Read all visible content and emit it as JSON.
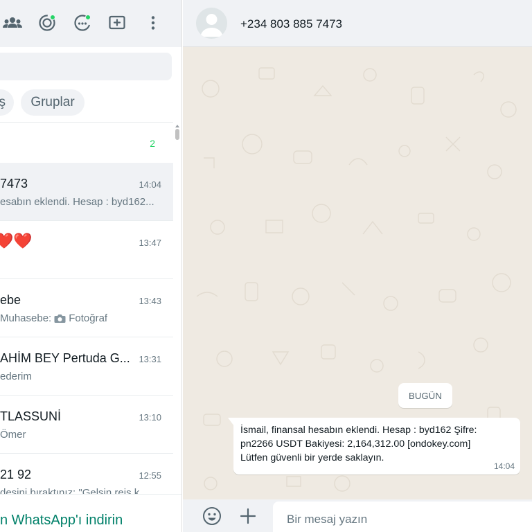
{
  "left_header": {
    "icons": [
      "communities-icon",
      "status-icon",
      "channels-icon",
      "new-chat-icon",
      "menu-icon"
    ]
  },
  "search": {
    "placeholder": ""
  },
  "filters": [
    {
      "label": "ş"
    },
    {
      "label": "Gruplar"
    }
  ],
  "archived": {
    "count": "2"
  },
  "chats": [
    {
      "name": "7473",
      "time": "14:04",
      "preview": "esabın eklendi. Hesap : byd162...",
      "active": true
    },
    {
      "name": "❤️❤️",
      "time": "13:47",
      "preview": ""
    },
    {
      "name": "ebe",
      "time": "13:43",
      "preview_prefix": "Muhasebe:",
      "preview": "Fotoğraf",
      "preview_icon": "camera-icon"
    },
    {
      "name": "AHİM BEY Pertuda G...",
      "time": "13:31",
      "preview": "ederim"
    },
    {
      "name": "TLASSUNİ",
      "time": "13:10",
      "preview": "Ömer"
    },
    {
      "name": "21 92",
      "time": "12:55",
      "preview": "desini bıraktınız: \"Gelsin reis k..."
    }
  ],
  "download": {
    "label": "n WhatsApp'ı indirin"
  },
  "conversation": {
    "contact_name": "+234 803 885 7473",
    "date_label": "BUGÜN",
    "message": {
      "lines": [
        "İsmail, finansal hesabın eklendi. Hesap : byd162 Şifre:",
        "pn2266 USDT Bakiyesi: 2,164,312.00  [ondokey.com]",
        "Lütfen güvenli bir yerde saklayın."
      ],
      "time": "14:04"
    }
  },
  "composer": {
    "placeholder": "Bir mesaj yazın"
  },
  "colors": {
    "accent": "#25d366",
    "link": "#008069",
    "chat_bg": "#efeae2",
    "panel": "#f0f2f5"
  }
}
